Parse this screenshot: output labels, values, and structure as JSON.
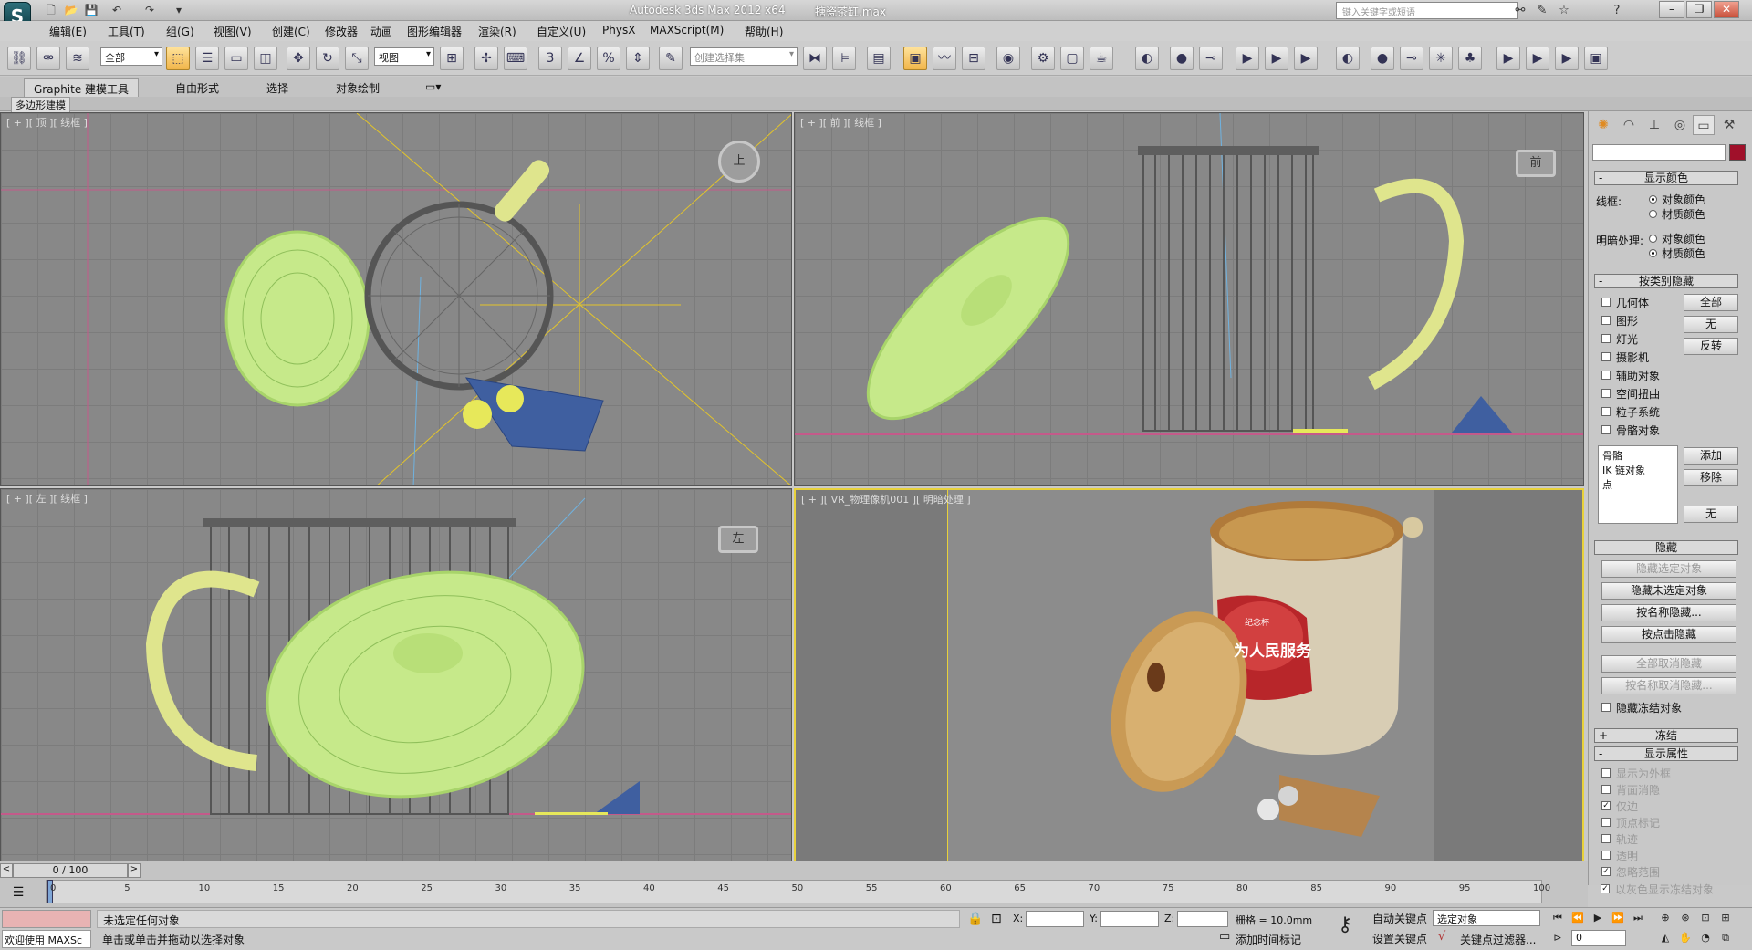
{
  "window": {
    "title": "Autodesk 3ds Max  2012 x64",
    "filename": "搪瓷茶缸.max",
    "search_placeholder": "键入关键字或短语"
  },
  "menu": [
    "编辑(E)",
    "工具(T)",
    "组(G)",
    "视图(V)",
    "创建(C)",
    "修改器",
    "动画",
    "图形编辑器",
    "渲染(R)",
    "自定义(U)",
    "PhysX",
    "MAXScript(M)",
    "帮助(H)"
  ],
  "toolbar": {
    "selection_filter": "全部",
    "ref_coord": "视图",
    "named_selection": "创建选择集",
    "snap_label": "3"
  },
  "ribbon": {
    "tabs": [
      "Graphite 建模工具",
      "自由形式",
      "选择",
      "对象绘制"
    ],
    "sub": "多边形建模"
  },
  "viewports": {
    "top": {
      "label": "[ + ][ 顶 ][ 线框 ]",
      "cube": "上"
    },
    "front": {
      "label": "[ + ][ 前 ][ 线框 ]",
      "cube": "前"
    },
    "left": {
      "label": "[ + ][ 左 ][ 线框 ]",
      "cube": "左"
    },
    "camera": {
      "label": "[ + ][ VR_物理像机001 ][ 明暗处理 ]",
      "mug_text": "为人民服务",
      "mug_small": "纪念杯"
    }
  },
  "panel": {
    "display_color": "显示颜色",
    "wireframe": "线框:",
    "shaded": "明暗处理:",
    "object_color": "对象颜色",
    "material_color": "材质颜色",
    "hide_by_category": "按类别隐藏",
    "categories": [
      "几何体",
      "图形",
      "灯光",
      "摄影机",
      "辅助对象",
      "空间扭曲",
      "粒子系统",
      "骨骼对象"
    ],
    "btn_all": "全部",
    "btn_none": "无",
    "btn_invert": "反转",
    "list_items": [
      "骨骼",
      "IK 链对象",
      "点"
    ],
    "btn_add": "添加",
    "btn_remove": "移除",
    "btn_none2": "无",
    "hide": "隐藏",
    "hide_selected": "隐藏选定对象",
    "hide_unselected": "隐藏未选定对象",
    "hide_by_name": "按名称隐藏...",
    "hide_by_hit": "按点击隐藏",
    "unhide_all": "全部取消隐藏",
    "unhide_by_name": "按名称取消隐藏...",
    "hide_frozen": "隐藏冻结对象",
    "freeze": "冻结",
    "display_props": "显示属性",
    "props": [
      "显示为外框",
      "背面消隐",
      "仅边",
      "顶点标记",
      "轨迹",
      "透明",
      "忽略范围",
      "以灰色显示冻结对象"
    ]
  },
  "timeline": {
    "frame": "0 / 100",
    "ticks": [
      "0",
      "5",
      "10",
      "15",
      "20",
      "25",
      "30",
      "35",
      "40",
      "45",
      "50",
      "55",
      "60",
      "65",
      "70",
      "75",
      "80",
      "85",
      "90",
      "95",
      "100"
    ]
  },
  "status": {
    "welcome": "欢迎使用 MAXSc",
    "line1": "未选定任何对象",
    "line2": "单击或单击并拖动以选择对象",
    "x": "X:",
    "y": "Y:",
    "z": "Z:",
    "grid": "栅格 = 10.0mm",
    "auto_key": "自动关键点",
    "set_key": "设置关键点",
    "selected": "选定对象",
    "add_time_tag": "添加时间标记",
    "key_filters": "关键点过滤器...",
    "frame_value": "0"
  }
}
